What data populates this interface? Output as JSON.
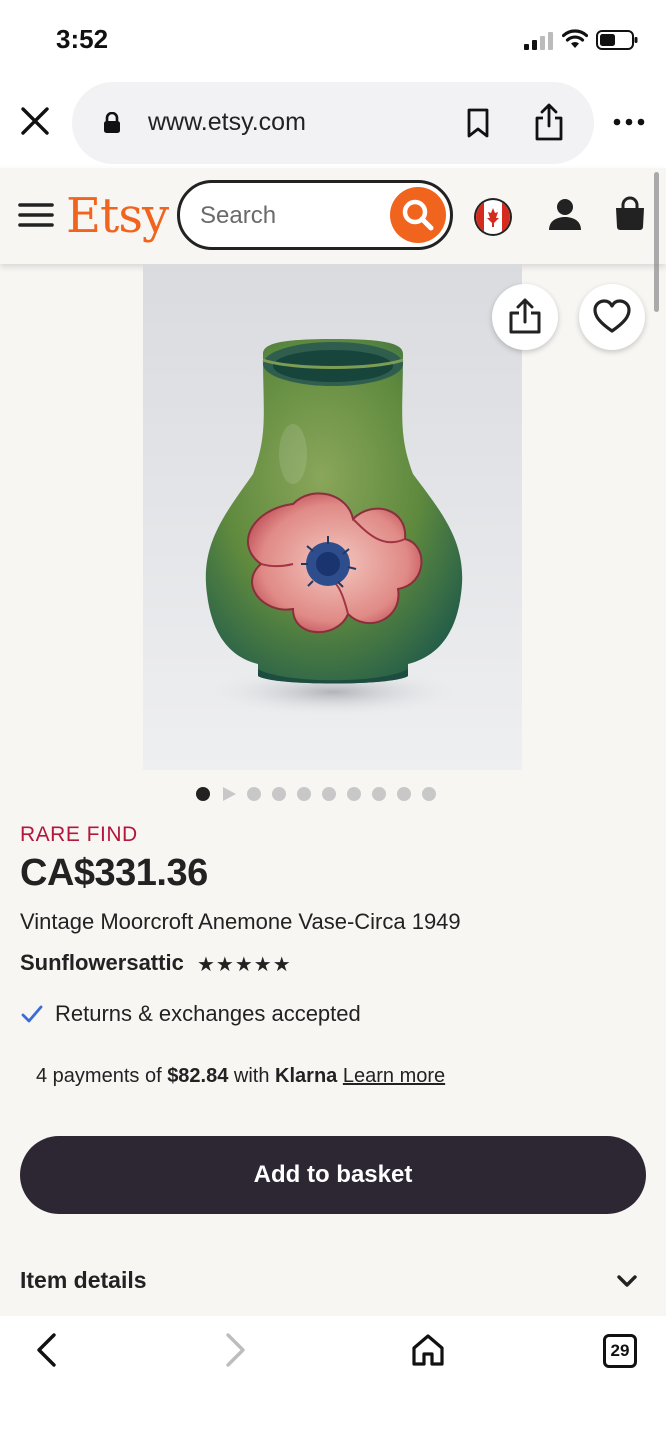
{
  "status_bar": {
    "time": "3:52"
  },
  "browser": {
    "url": "www.etsy.com",
    "tab_count": "29"
  },
  "header": {
    "logo": "Etsy",
    "search_placeholder": "Search"
  },
  "gallery": {
    "total_images": 10,
    "current_index": 1
  },
  "product": {
    "badge": "RARE FIND",
    "price": "CA$331.36",
    "title": "Vintage Moorcroft Anemone Vase-Circa 1949",
    "shop_name": "Sunflowersattic",
    "stars": "★★★★★",
    "rating": 5,
    "returns": "Returns & exchanges accepted",
    "klarna": {
      "prefix": "4 payments of ",
      "amount": "$82.84",
      "middle": " with ",
      "provider": "Klarna",
      "link": "Learn more"
    },
    "add_button": "Add to basket",
    "details_label": "Item details"
  },
  "colors": {
    "brand": "#f1641e",
    "badge": "#b3183b",
    "button": "#2d2633",
    "background": "#f7f6f3"
  }
}
